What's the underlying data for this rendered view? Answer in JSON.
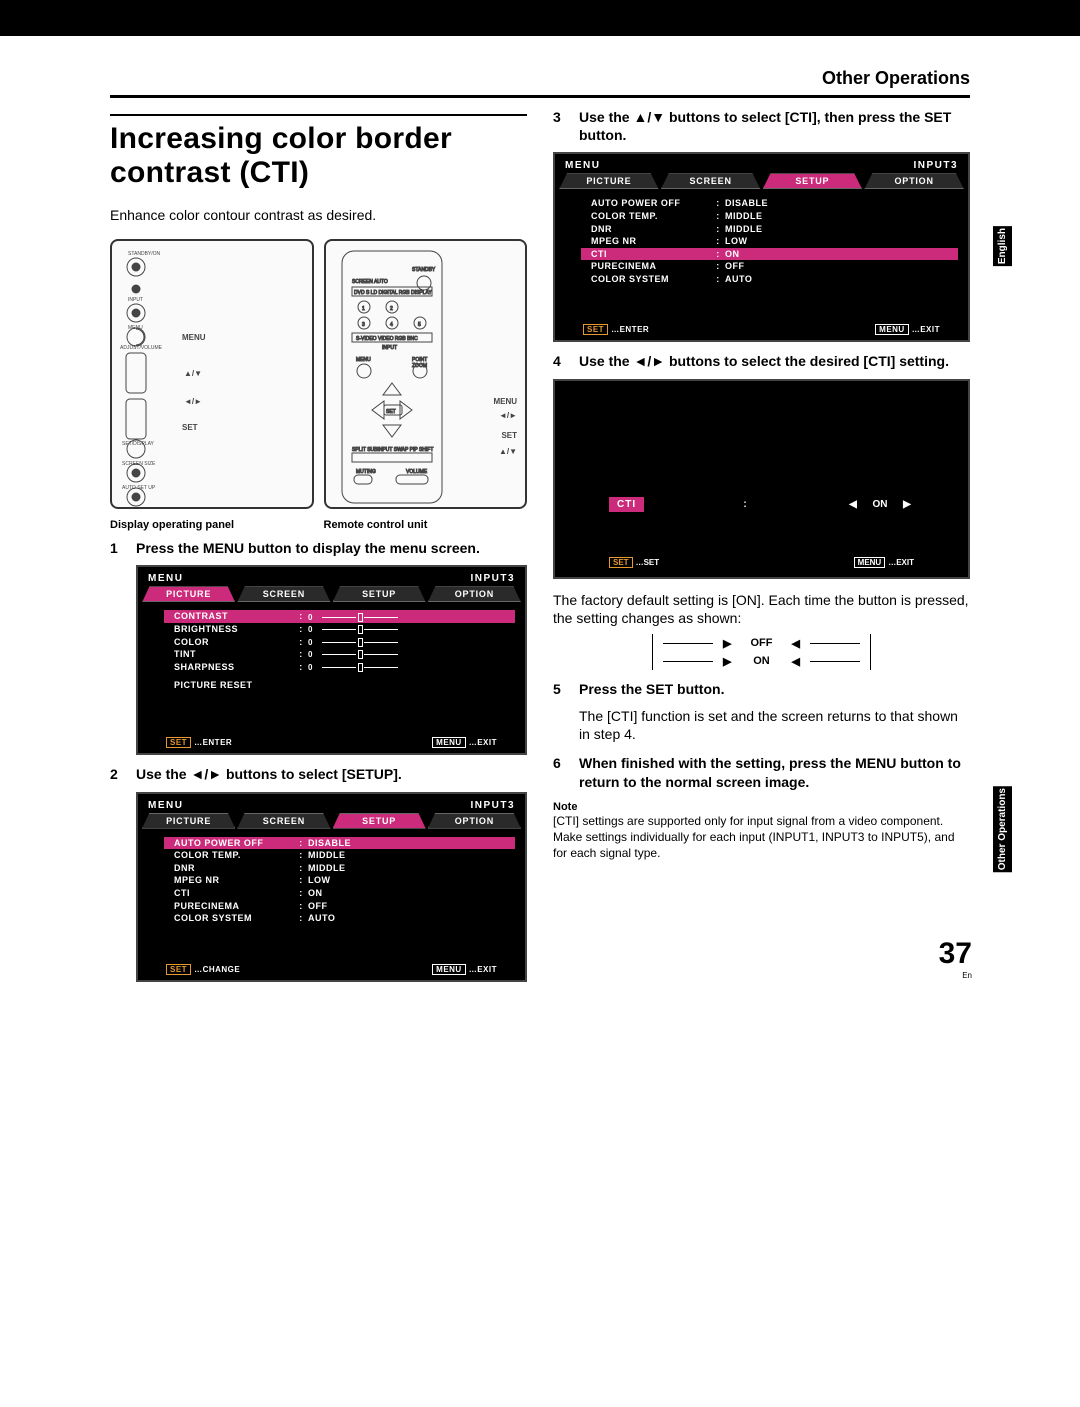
{
  "running_head": "Other Operations",
  "title": "Increasing color border contrast (CTI)",
  "intro": "Enhance color contour contrast as desired.",
  "side_tab_lang": "English",
  "side_tab_section": "Other Operations",
  "page_number": "37",
  "page_lang_abbr": "En",
  "fig": {
    "panel_caption": "Display operating panel",
    "remote_caption": "Remote control unit",
    "labels": {
      "menu": "MENU",
      "set": "SET",
      "updown": "▲/▼",
      "leftright": "◄/►"
    }
  },
  "steps": {
    "1": {
      "head": "Press the MENU button to display the menu screen."
    },
    "2": {
      "head": "Use the ◄/► buttons to select [SETUP]."
    },
    "3": {
      "head": "Use the ▲/▼ buttons to select [CTI], then press the SET button."
    },
    "4": {
      "head": "Use the ◄/► buttons to select the desired [CTI] setting.",
      "followup": "The factory default setting is [ON]. Each time the button is pressed, the setting changes as shown:"
    },
    "5": {
      "head": "Press the SET button.",
      "body": "The [CTI] function is set and the screen returns to that shown in step 4."
    },
    "6": {
      "head": "When finished with the setting, press the MENU button to return to the normal screen image."
    }
  },
  "toggle": {
    "off": "OFF",
    "on": "ON"
  },
  "menu": {
    "title": "MENU",
    "input": "INPUT3",
    "tabs": {
      "picture": "PICTURE",
      "screen": "SCREEN",
      "setup": "SETUP",
      "option": "OPTION"
    },
    "picture_rows": [
      {
        "k": "CONTRAST",
        "v": "0"
      },
      {
        "k": "BRIGHTNESS",
        "v": "0"
      },
      {
        "k": "COLOR",
        "v": "0"
      },
      {
        "k": "TINT",
        "v": "0"
      },
      {
        "k": "SHARPNESS",
        "v": "0"
      }
    ],
    "picture_reset": "PICTURE RESET",
    "setup_rows": [
      {
        "k": "AUTO POWER OFF",
        "v": "DISABLE"
      },
      {
        "k": "COLOR TEMP.",
        "v": "MIDDLE"
      },
      {
        "k": "DNR",
        "v": "MIDDLE"
      },
      {
        "k": "MPEG NR",
        "v": "LOW"
      },
      {
        "k": "CTI",
        "v": "ON"
      },
      {
        "k": "PURECINEMA",
        "v": "OFF"
      },
      {
        "k": "COLOR SYSTEM",
        "v": "AUTO"
      }
    ],
    "footer": {
      "set": "SET",
      "enter": "…ENTER",
      "change": "…CHANGE",
      "setaction": "…SET",
      "menu": "MENU",
      "exit": "…EXIT"
    }
  },
  "cti_box": {
    "label": "CTI",
    "value": "ON"
  },
  "note": {
    "head": "Note",
    "body": "[CTI] settings are supported only for input signal from a video component. Make settings individually for each input (INPUT1, INPUT3 to INPUT5), and for each signal type."
  }
}
